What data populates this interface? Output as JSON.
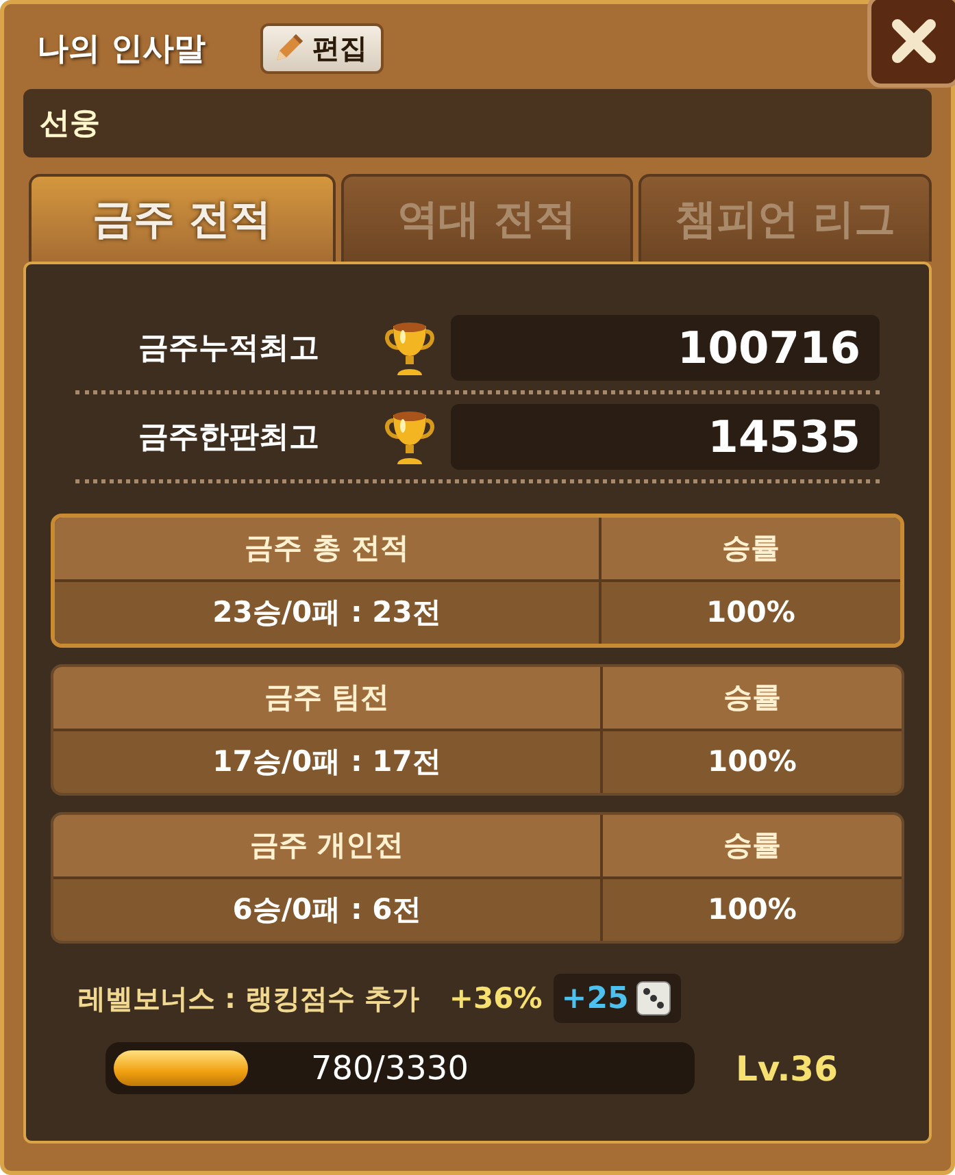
{
  "header": {
    "title": "나의 인사말",
    "edit_button": "편집"
  },
  "greeting": {
    "value": "선웅"
  },
  "tabs": [
    {
      "label": "금주 전적",
      "selected": true
    },
    {
      "label": "역대 전적",
      "selected": false
    },
    {
      "label": "챔피언 리그",
      "selected": false
    }
  ],
  "records": [
    {
      "label": "금주누적최고",
      "value": "100716"
    },
    {
      "label": "금주한판최고",
      "value": "14535"
    }
  ],
  "tables": [
    {
      "title": "금주 총 전적",
      "rate_label": "승률",
      "result": "23승/0패 : 23전",
      "rate": "100%",
      "selected": true
    },
    {
      "title": "금주 팀전",
      "rate_label": "승률",
      "result": "17승/0패 : 17전",
      "rate": "100%",
      "selected": false
    },
    {
      "title": "금주 개인전",
      "rate_label": "승률",
      "result": "6승/0패 : 6전",
      "rate": "100%",
      "selected": false
    }
  ],
  "bonus": {
    "label": "레벨보너스 : 랭킹점수 추가",
    "percent": "+36%",
    "dice": "+25"
  },
  "experience": {
    "level": 0.234,
    "reading": "780/3330",
    "level_label": "Lv.36"
  }
}
